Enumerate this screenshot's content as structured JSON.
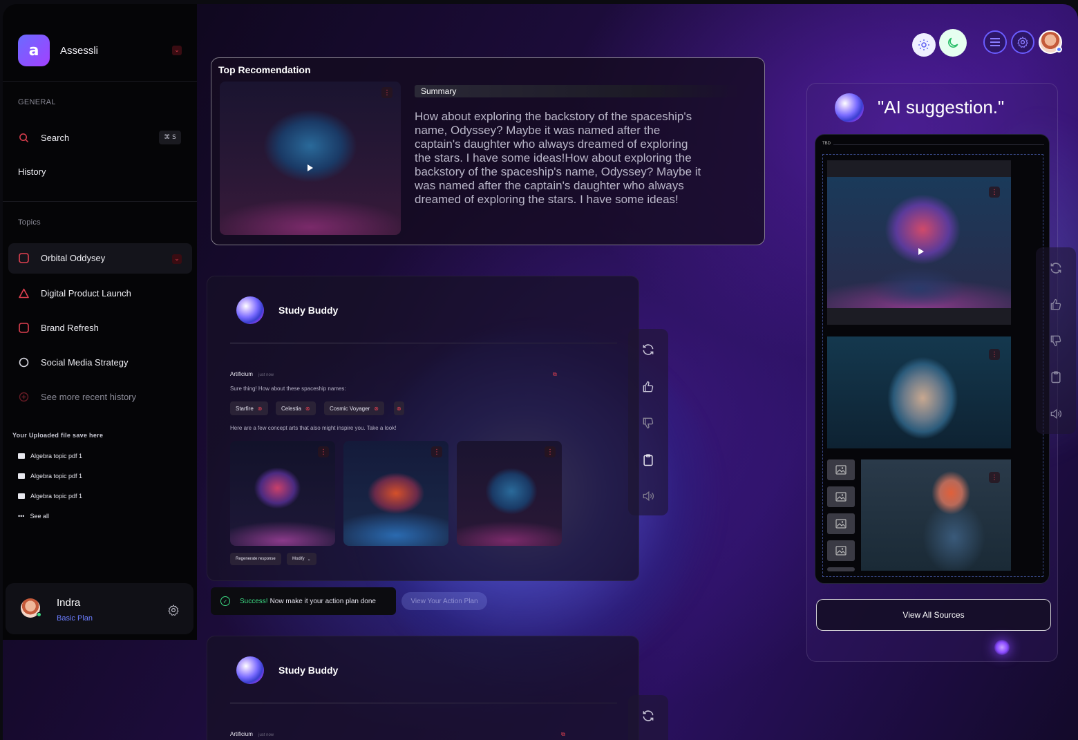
{
  "brand": {
    "name": "Assessli",
    "logo_glyph": "a"
  },
  "sidebar": {
    "general_caption": "GENERAL",
    "search_label": "Search",
    "search_shortcut": "⌘ S",
    "history_label": "History",
    "topics_caption": "Topics",
    "topics": [
      {
        "label": "Orbital Oddysey",
        "icon": "square-icon"
      },
      {
        "label": "Digital Product Launch",
        "icon": "triangle-icon"
      },
      {
        "label": "Brand Refresh",
        "icon": "square-icon"
      },
      {
        "label": "Social Media Strategy",
        "icon": "circle-icon"
      }
    ],
    "see_more_label": "See more recent history",
    "files_caption": "Your Uploaded file save here",
    "files": [
      "Algebra topic pdf 1",
      "Algebra topic pdf 1",
      "Algebra topic pdf 1"
    ],
    "see_all_label": "See all"
  },
  "user": {
    "name": "Indra",
    "plan": "Basic Plan"
  },
  "top_recommendation": {
    "title": "Top Recomendation",
    "summary_label": "Summary",
    "summary_text": "How about exploring the backstory of the spaceship's name, Odyssey? Maybe it was named after the captain's daughter who always dreamed of exploring the stars. I have some ideas!How about exploring the backstory of the spaceship's name, Odyssey? Maybe it was named after the captain's daughter who always dreamed of exploring the stars. I have some ideas!"
  },
  "study_buddy": {
    "title": "Study Buddy",
    "sender": "Artificium",
    "time": "just now",
    "message": "Sure thing! How about these spaceship names:",
    "names": [
      "Starfire",
      "Celestia",
      "Cosmic Voyager"
    ],
    "concept_text": "Here are a few concept arts that also might inspire you. Take a look!",
    "regenerate_label": "Regenerate response",
    "modify_label": "Modify"
  },
  "study_buddy_2": {
    "title": "Study Buddy",
    "sender": "Artificium",
    "time": "just now"
  },
  "toast": {
    "success_word": "Success!",
    "message": "Now make it your action plan done",
    "ghost_button": "View Your Action Plan"
  },
  "ai_panel": {
    "title": "\"AI suggestion.\"",
    "tag": "TBD",
    "view_all_label": "View All Sources"
  },
  "colors": {
    "accent_red": "#e04050",
    "accent_purple": "#7b5cff",
    "success_green": "#3ddc84",
    "plan_blue": "#6b7dff"
  }
}
